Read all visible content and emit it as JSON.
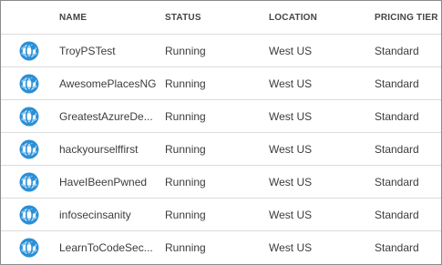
{
  "columns": {
    "name": "NAME",
    "status": "STATUS",
    "location": "LOCATION",
    "pricing_tier": "PRICING TIER"
  },
  "rows": [
    {
      "icon": "website-globe-icon",
      "name": "TroyPSTest",
      "status": "Running",
      "location": "West US",
      "pricing_tier": "Standard"
    },
    {
      "icon": "website-globe-icon",
      "name": "AwesomePlacesNG",
      "status": "Running",
      "location": "West US",
      "pricing_tier": "Standard"
    },
    {
      "icon": "website-globe-icon",
      "name": "GreatestAzureDe...",
      "status": "Running",
      "location": "West US",
      "pricing_tier": "Standard"
    },
    {
      "icon": "website-globe-icon",
      "name": "hackyourselffirst",
      "status": "Running",
      "location": "West US",
      "pricing_tier": "Standard"
    },
    {
      "icon": "website-globe-icon",
      "name": "HaveIBeenPwned",
      "status": "Running",
      "location": "West US",
      "pricing_tier": "Standard"
    },
    {
      "icon": "website-globe-icon",
      "name": "infosecinsanity",
      "status": "Running",
      "location": "West US",
      "pricing_tier": "Standard"
    },
    {
      "icon": "website-globe-icon",
      "name": "LearnToCodeSec...",
      "status": "Running",
      "location": "West US",
      "pricing_tier": "Standard"
    }
  ],
  "colors": {
    "icon_blue": "#2a8fd6",
    "icon_light": "#8fcaf0",
    "divider": "#dcdcdc",
    "text": "#3c3c3c"
  }
}
